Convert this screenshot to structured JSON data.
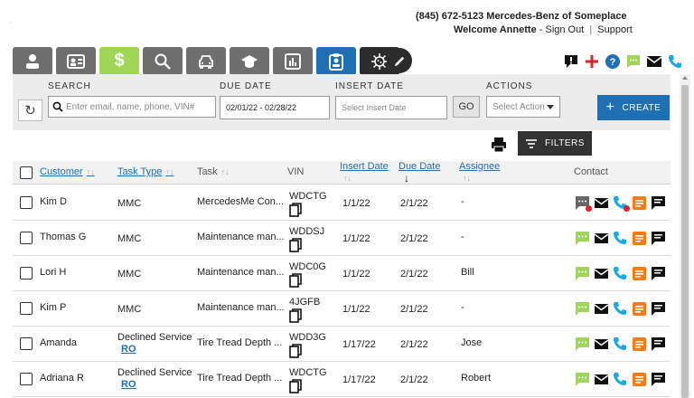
{
  "header": {
    "phone_dealer": "(845) 672-5123 Mercedes-Benz of Someplace",
    "welcome": "Welcome Annette",
    "sign_out": "Sign Out",
    "support": "Support",
    "separator_1": "-",
    "separator_2": "|"
  },
  "nav": {
    "tabs": [
      {
        "icon": "user-icon"
      },
      {
        "icon": "contact-card-icon"
      },
      {
        "icon": "dollar-icon",
        "label": "$"
      },
      {
        "icon": "search-icon"
      },
      {
        "icon": "car-icon"
      },
      {
        "icon": "graduation-cap-icon"
      },
      {
        "icon": "bar-chart-icon"
      },
      {
        "icon": "clipboard-user-icon"
      },
      {
        "icon": "virus-icon"
      }
    ],
    "edit_icon": "pencil-icon"
  },
  "top_icons": [
    "alert-icon",
    "add-icon",
    "help-icon",
    "chat-icon",
    "mail-icon",
    "phone-icon"
  ],
  "filters": {
    "search_label": "SEARCH",
    "search_placeholder": "Enter email, name, phone, VIN#",
    "due_date_label": "DUE DATE",
    "due_date_value": "02/01/22 - 02/28/22",
    "insert_date_label": "INSERT DATE",
    "insert_date_placeholder": "Select Insert Date",
    "go_label": "GO",
    "actions_label": "ACTIONS",
    "actions_placeholder": "Select Action",
    "create_label": "CREATE",
    "filters_label": "FILTERS"
  },
  "table": {
    "columns": {
      "customer": "Customer",
      "task_type": "Task Type",
      "task": "Task",
      "vin": "VIN",
      "insert_date": "Insert Date",
      "due_date": "Due Date",
      "assignee": "Assignee",
      "contact": "Contact"
    },
    "sort_glyph": "↑↓",
    "due_date_arrow": "↓",
    "rows": [
      {
        "customer": "Kim D",
        "task_type": "MMC",
        "ro": "",
        "task": "MercedesMe Con...",
        "vin": "WDCTG",
        "insert_date": "1/1/22",
        "due_date": "2/1/22",
        "assignee": "-",
        "chat_alert": true
      },
      {
        "customer": "Thomas G",
        "task_type": "MMC",
        "ro": "",
        "task": "Maintenance man...",
        "vin": "WDDSJ",
        "insert_date": "1/1/22",
        "due_date": "2/1/22",
        "assignee": "-",
        "chat_alert": false
      },
      {
        "customer": "Lori H",
        "task_type": "MMC",
        "ro": "",
        "task": "Maintenance man...",
        "vin": "WDC0G",
        "insert_date": "1/1/22",
        "due_date": "2/1/22",
        "assignee": "Bill",
        "chat_alert": false
      },
      {
        "customer": "Kim P",
        "task_type": "MMC",
        "ro": "",
        "task": "Maintenance man...",
        "vin": "4JGFB",
        "insert_date": "1/1/22",
        "due_date": "2/1/22",
        "assignee": "-",
        "chat_alert": false
      },
      {
        "customer": "Amanda",
        "task_type": "Declined Service",
        "ro": "RO",
        "task": "Tire Tread Depth ...",
        "vin": "WDD3G",
        "insert_date": "1/17/22",
        "due_date": "2/1/22",
        "assignee": "Jose",
        "chat_alert": false
      },
      {
        "customer": "Adriana R",
        "task_type": "Declined Service",
        "ro": "RO",
        "task": "Tire Tread Depth ...",
        "vin": "WDCTG",
        "insert_date": "1/17/22",
        "due_date": "2/1/22",
        "assignee": "Robert",
        "chat_alert": false
      }
    ]
  },
  "colors": {
    "accent_blue": "#1f6fb5",
    "active_green": "#9fd656",
    "alert_red": "#d9232e",
    "phone_cyan": "#1aa9e0",
    "note_orange": "#f07d1a"
  }
}
